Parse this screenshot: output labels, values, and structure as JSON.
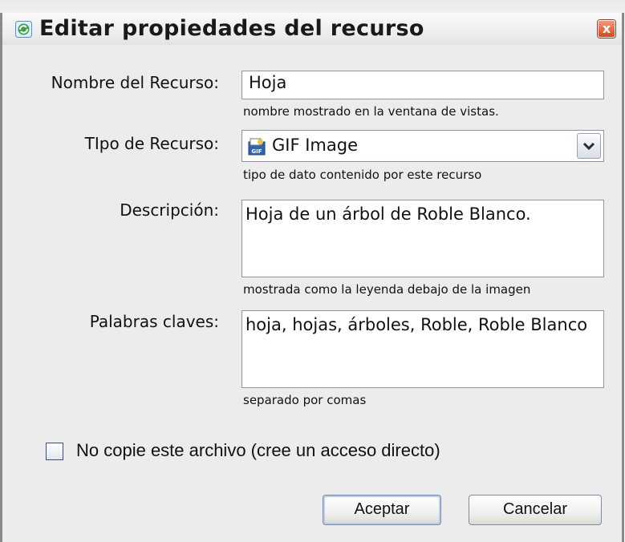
{
  "dialog": {
    "title": "Editar propiedades del recurso",
    "close_label": "x"
  },
  "fields": {
    "name": {
      "label": "Nombre del Recurso:",
      "value": "Hoja",
      "hint": "nombre mostrado en la ventana de vistas."
    },
    "type": {
      "label": "TIpo de Recurso:",
      "icon": "gif-file-icon",
      "value": "GIF Image",
      "hint": "tipo de dato contenido por este recurso"
    },
    "description": {
      "label": "Descripción:",
      "value": "Hoja de un árbol de Roble Blanco.",
      "hint": "mostrada como la leyenda debajo de la imagen"
    },
    "keywords": {
      "label": "Palabras claves:",
      "value": "hoja, hojas, árboles, Roble, Roble Blanco",
      "hint": "separado por comas"
    }
  },
  "options": {
    "no_copy_checked": false,
    "no_copy_label": "No copie este archivo  (cree un acceso directo)"
  },
  "buttons": {
    "ok_label": "Aceptar",
    "cancel_label": "Cancelar"
  },
  "colors": {
    "title_icon": "#3aa14a",
    "close_button": "#d8461f",
    "default_button_ring": "#b8cbef"
  }
}
